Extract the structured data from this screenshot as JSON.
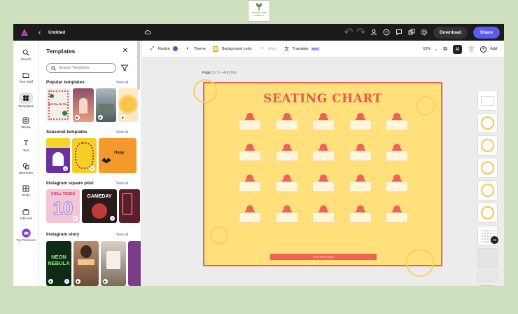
{
  "watermark": {
    "logo_text": "ROSEHIP AND LITERACY",
    "icon": "leaf-icon"
  },
  "topbar": {
    "doc_title": "Untitled",
    "download_label": "Download",
    "share_label": "Share",
    "icons": [
      "adobe-express-logo",
      "back-icon",
      "cloud-icon",
      "undo-icon",
      "redo-icon",
      "invite-icon",
      "help-icon",
      "comment-icon",
      "shapes-icon",
      "settings-icon"
    ]
  },
  "rail": {
    "items": [
      {
        "label": "Search",
        "icon": "search-icon"
      },
      {
        "label": "Your stuff",
        "icon": "folder-icon"
      },
      {
        "label": "Templates",
        "icon": "templates-icon",
        "active": true
      },
      {
        "label": "Media",
        "icon": "media-icon"
      },
      {
        "label": "Text",
        "icon": "text-icon"
      },
      {
        "label": "Elements",
        "icon": "elements-icon"
      },
      {
        "label": "Grids",
        "icon": "grid-icon"
      },
      {
        "label": "Add-ons",
        "icon": "addons-icon"
      },
      {
        "label": "Try Premium",
        "icon": "crown-icon"
      }
    ]
  },
  "panel": {
    "title": "Templates",
    "search_placeholder": "Search Templates",
    "view_all": "View all",
    "sections": [
      {
        "title": "Popular templates"
      },
      {
        "title": "Seasonal templates"
      },
      {
        "title": "Instagram square post"
      },
      {
        "title": "Instagram story"
      }
    ],
    "thumb_texts": {
      "popular_1": "Will You Be My...",
      "seasonal_3": "Happ",
      "insta_1": "CHILL TUNES",
      "insta_1_num": "10",
      "insta_2": "GAMEDAY",
      "story_1": "NEON NEBULA"
    }
  },
  "toolbar": {
    "resize": "Resize",
    "theme": "Theme",
    "background_color": "Background color",
    "align": "Align",
    "translate": "Translate",
    "new_badge": "NEW",
    "zoom": "63%",
    "add": "Add"
  },
  "canvas": {
    "page_label": "Page 1 / 1",
    "add_title": "– Add title",
    "design_title": "SEATING CHART",
    "footer_text": "WHITEBOARD",
    "seat_rows": 4,
    "seat_cols": 5,
    "colors": {
      "background": "#ffe07a",
      "accent": "#ef6258"
    }
  },
  "thumbs": {
    "count_badge": "25"
  }
}
